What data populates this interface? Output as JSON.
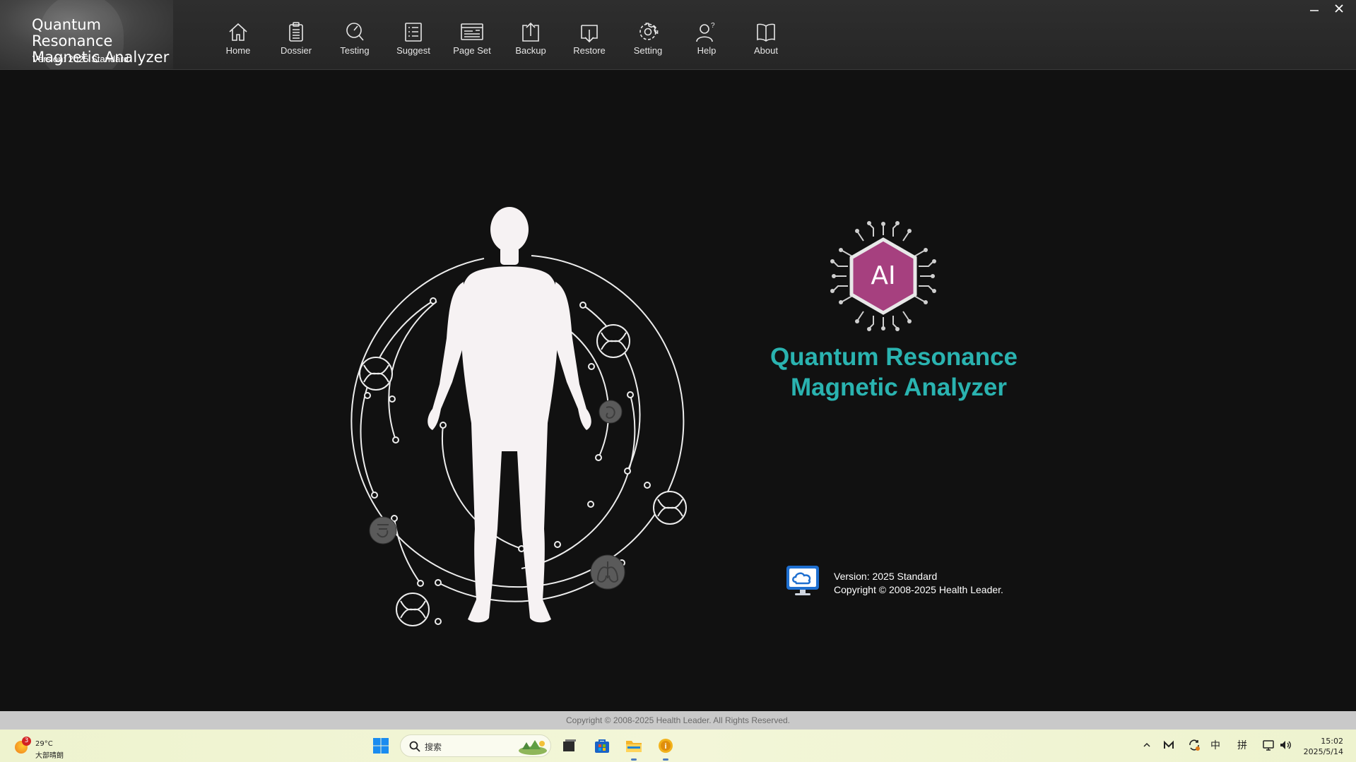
{
  "app": {
    "title": "Quantum Resonance Magnetic Analyzer",
    "title_line1": "Quantum Resonance",
    "title_line2": "Magnetic Analyzer",
    "version_label": "Version: 2025 Standard"
  },
  "toolbar": [
    {
      "label": "Home",
      "icon": "home-icon"
    },
    {
      "label": "Dossier",
      "icon": "clipboard-icon"
    },
    {
      "label": "Testing",
      "icon": "gauge-icon"
    },
    {
      "label": "Suggest",
      "icon": "list-icon"
    },
    {
      "label": "Page Set",
      "icon": "page-layout-icon"
    },
    {
      "label": "Backup",
      "icon": "upload-icon"
    },
    {
      "label": "Restore",
      "icon": "download-icon"
    },
    {
      "label": "Setting",
      "icon": "gear-icon"
    },
    {
      "label": "Help",
      "icon": "help-person-icon"
    },
    {
      "label": "About",
      "icon": "book-icon"
    }
  ],
  "window": {
    "minimize": "–",
    "close": "✕"
  },
  "main": {
    "ai_badge": "AI",
    "app_name_line1": "Quantum Resonance",
    "app_name_line2": "Magnetic Analyzer",
    "version": "Version: 2025 Standard",
    "copyright": "Copyright © 2008-2025 Health Leader."
  },
  "footer": {
    "copyright": "Copyright © 2008-2025 Health Leader. All Rights Reserved."
  },
  "taskbar": {
    "weather_temp": "29°C",
    "weather_desc": "大部晴朗",
    "weather_badge": "3",
    "search_placeholder": "搜索",
    "tray_ime_lang": "中",
    "tray_ime_mode": "拼",
    "time": "15:02",
    "date": "2025/5/14"
  },
  "colors": {
    "accent_teal": "#2ab3b0",
    "ai_hex": "#a6407f",
    "background": "#111111",
    "monitor_blue": "#1e6fd0"
  }
}
